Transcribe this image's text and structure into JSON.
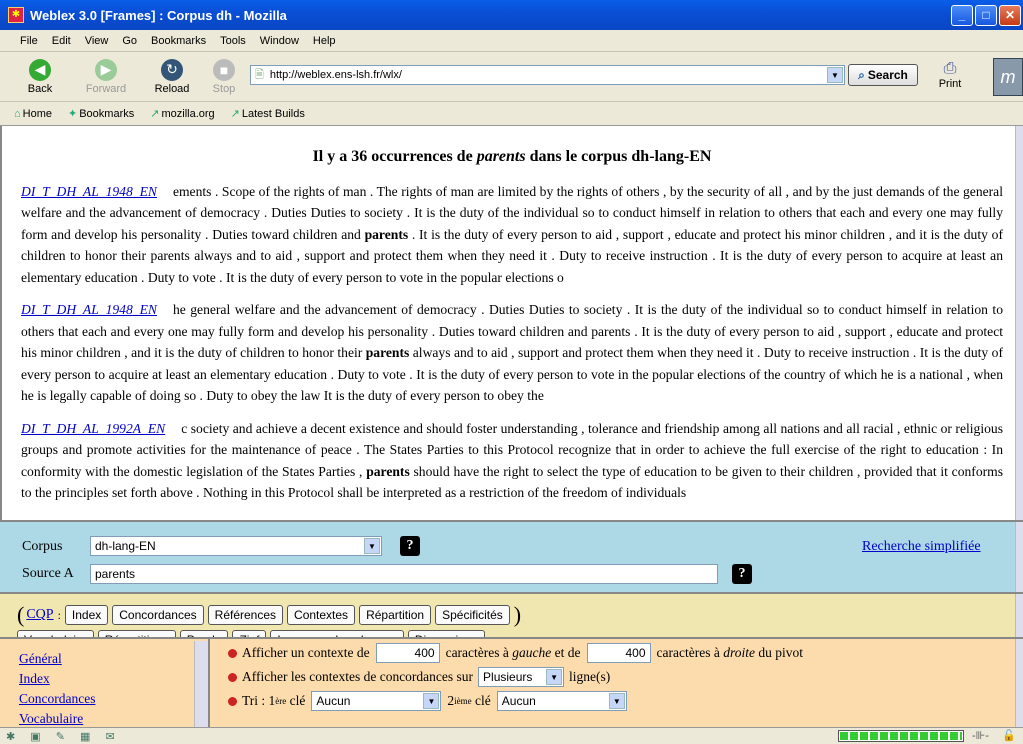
{
  "window": {
    "title": "Weblex 3.0 [Frames] : Corpus dh - Mozilla"
  },
  "menu": [
    "File",
    "Edit",
    "View",
    "Go",
    "Bookmarks",
    "Tools",
    "Window",
    "Help"
  ],
  "nav": {
    "back": "Back",
    "forward": "Forward",
    "reload": "Reload",
    "stop": "Stop",
    "url": "http://weblex.ens-lsh.fr/wlx/",
    "search": "Search",
    "print": "Print"
  },
  "bookmarks": [
    "Home",
    "Bookmarks",
    "mozilla.org",
    "Latest Builds"
  ],
  "results": {
    "heading_pre": "Il y a 36 occurrences de ",
    "heading_term": "parents",
    "heading_post": " dans le corpus dh-lang-EN",
    "items": [
      {
        "ref": "DI_T_DH_AL_1948_EN",
        "pre": "ements . Scope of the rights of man . The rights of man are limited by the rights of others , by the security of all , and by the just demands of the general welfare and the advancement of democracy . Duties Duties to society . It is the duty of the individual so to conduct himself in relation to others that each and every one may fully form and develop his personality . Duties toward children and ",
        "hit": "parents",
        "post": " . It is the duty of every person to aid , support , educate and protect his minor children , and it is the duty of children to honor their parents always and to aid , support and protect them when they need it . Duty to receive instruction . It is the duty of every person to acquire at least an elementary education . Duty to vote . It is the duty of every person to vote in the popular elections o"
      },
      {
        "ref": "DI_T_DH_AL_1948_EN",
        "pre": "he general welfare and the advancement of democracy . Duties Duties to society . It is the duty of the individual so to conduct himself in relation to others that each and every one may fully form and develop his personality . Duties toward children and parents . It is the duty of every person to aid , support , educate and protect his minor children , and it is the duty of children to honor their ",
        "hit": "parents",
        "post": " always and to aid , support and protect them when they need it . Duty to receive instruction . It is the duty of every person to acquire at least an elementary education . Duty to vote . It is the duty of every person to vote in the popular elections of the country of which he is a national , when he is legally capable of doing so . Duty to obey the law It is the duty of every person to obey the"
      },
      {
        "ref": "DI_T_DH_AL_1992A_EN",
        "pre": "c society and achieve a decent existence and should foster understanding , tolerance and friendship among all nations and all racial , ethnic or religious groups and promote activities for the maintenance of peace . The States Parties to this Protocol recognize that in order to achieve the full exercise of the right to education : In conformity with the domestic legislation of the States Parties , ",
        "hit": "parents",
        "post": " should have the right to select the type of education to be given to their children , provided that it conforms to the principles set forth above . Nothing in this Protocol shall be interpreted as a restriction of the freedom of individuals"
      }
    ]
  },
  "search_form": {
    "corpus_label": "Corpus",
    "corpus_value": "dh-lang-EN",
    "source_label": "Source A",
    "source_value": "parents",
    "simple_link": "Recherche simplifiée",
    "help": "?"
  },
  "tools": {
    "cqp": "CQP",
    "open": "(",
    "colon": ":",
    "close": ")",
    "buttons": [
      "Index",
      "Concordances",
      "Références",
      "Contextes",
      "Répartition",
      "Spécificités"
    ],
    "row2": [
      "Vocabulaire",
      "Répartitions",
      "Parole",
      "Zipf",
      "Longueur des phrases",
      "Dimensions"
    ]
  },
  "leftnav": [
    "Général",
    "Index",
    "Concordances",
    "Vocabulaire"
  ],
  "options": {
    "ctx_pre": "Afficher un contexte de",
    "left_val": "400",
    "ctx_mid": "caractères à",
    "gauche": "gauche",
    "et_de": "et de",
    "right_val": "400",
    "ctx_mid2": "caractères à",
    "droite": "droite",
    "ctx_post": "du pivot",
    "lines_pre": "Afficher les contextes de concordances sur",
    "lines_val": "Plusieurs",
    "lines_post": "ligne(s)",
    "tri": "Tri : 1",
    "ere": "ère",
    "cle": "clé",
    "key1": "Aucun",
    "deux": "2",
    "ieme": "ième",
    "key2": "Aucun"
  },
  "status": {
    "progress": 1.0
  }
}
